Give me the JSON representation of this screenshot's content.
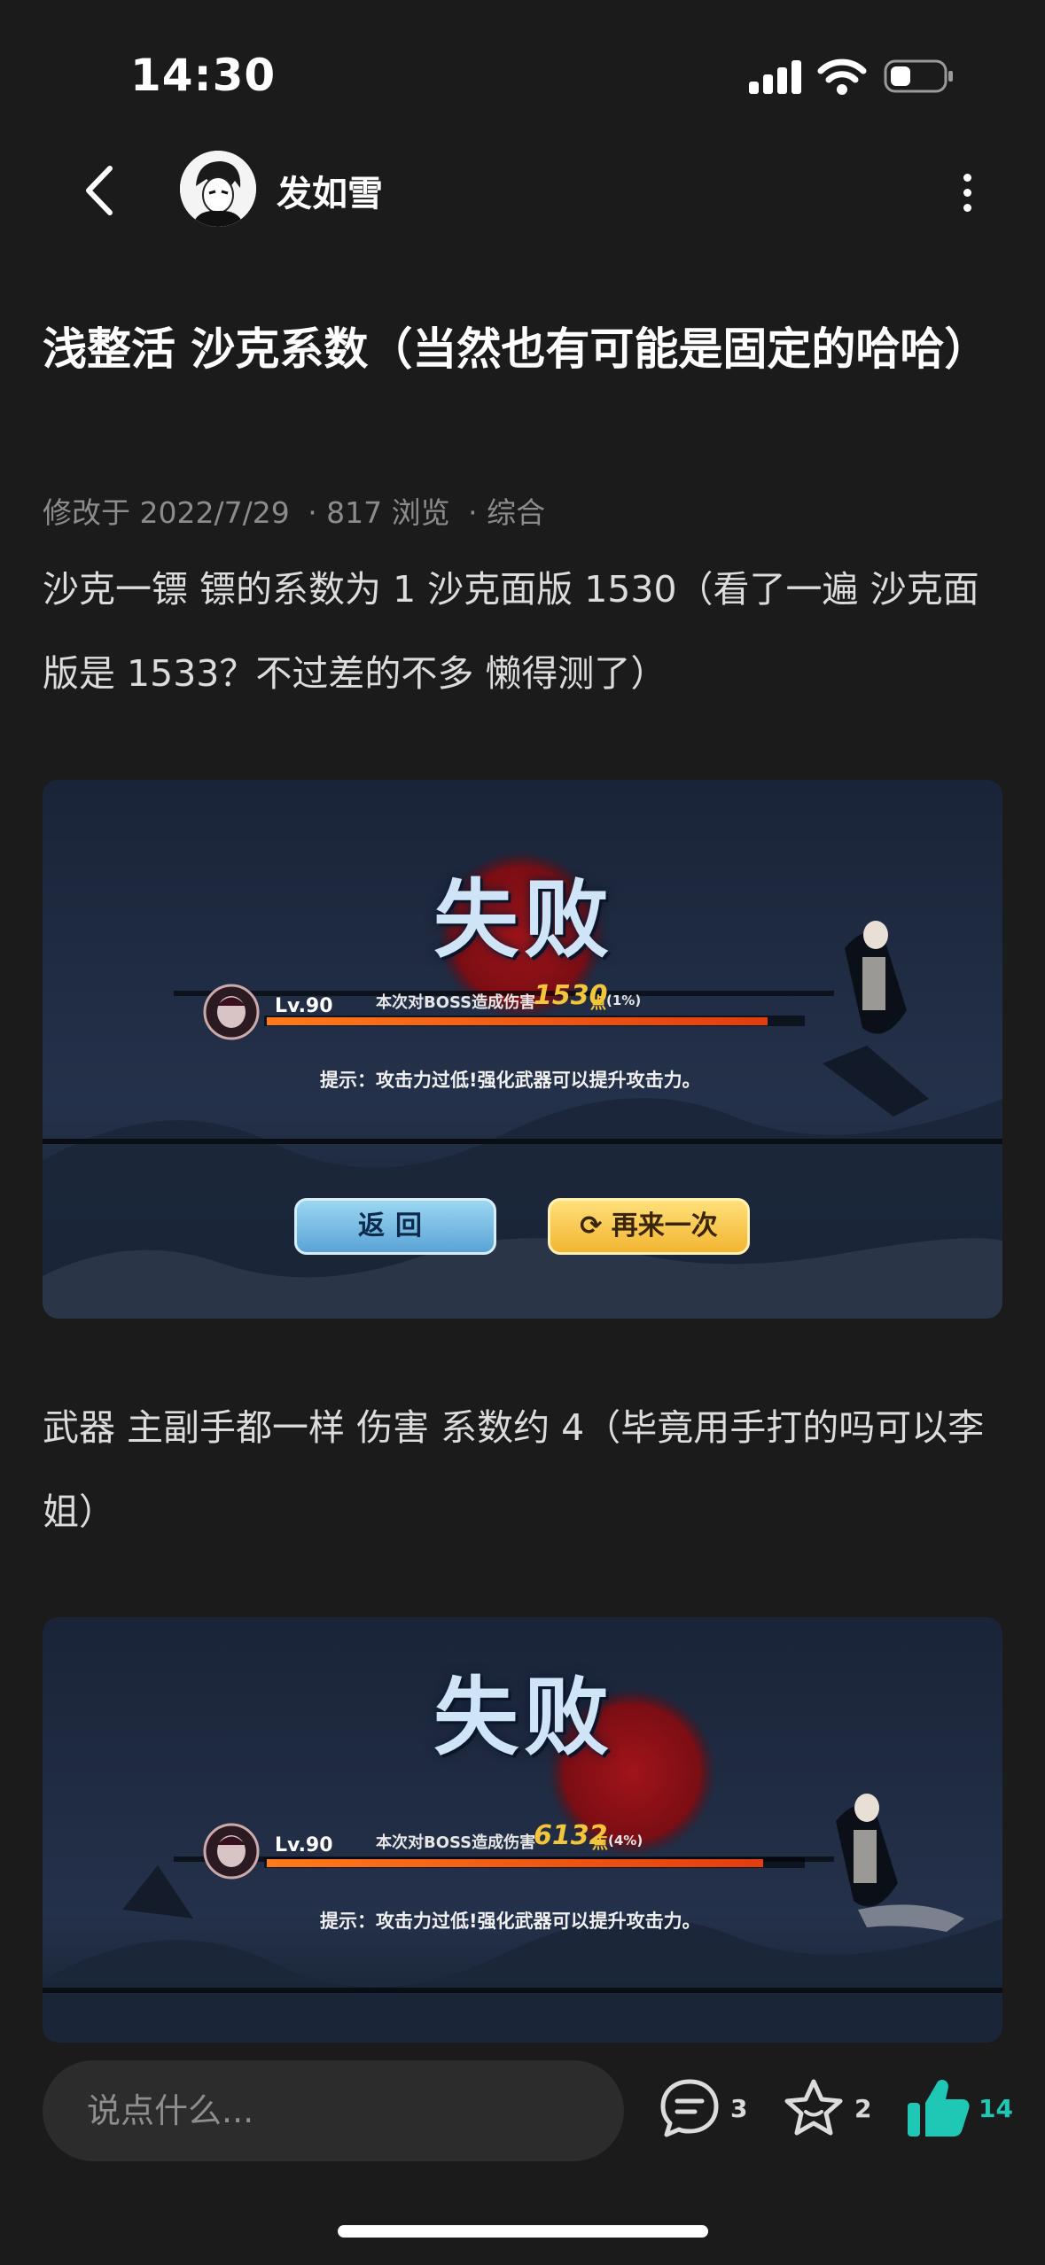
{
  "status_bar": {
    "time": "14:30"
  },
  "header": {
    "author_name": "发如雪"
  },
  "post": {
    "title": "浅整活 沙克系数（当然也有可能是固定的哈哈）",
    "meta": {
      "modified": "修改于 2022/7/29",
      "views": "· 817 浏览",
      "category": "· 综合"
    },
    "paragraph_1": "沙克一镖 镖的系数为 1 沙克面版 1530（看了一遍 沙克面版是 1533？不过差的不多 懒得测了）",
    "paragraph_2": "武器 主副手都一样 伤害 系数约 4（毕竟用手打的吗可以李姐）"
  },
  "screenshots": [
    {
      "title": "失败",
      "level": "Lv.90",
      "damage_label": "本次对BOSS造成伤害",
      "damage_value": "1530",
      "damage_unit": "点",
      "damage_percent": "(1%)",
      "health_fraction": 0.99,
      "tip": "提示：攻击力过低!强化武器可以提升攻击力。",
      "back_button": "返回",
      "retry_button": "再来一次"
    },
    {
      "title": "失败",
      "level": "Lv.90",
      "damage_label": "本次对BOSS造成伤害",
      "damage_value": "6132",
      "damage_unit": "点",
      "damage_percent": "(4%)",
      "health_fraction": 0.96,
      "tip": "提示：攻击力过低!强化武器可以提升攻击力。"
    }
  ],
  "bottom_bar": {
    "comment_placeholder": "说点什么...",
    "comments_count": "3",
    "favorites_count": "2",
    "likes_count": "14"
  },
  "colors": {
    "background": "#1b1b1b",
    "like_accent": "#1fc8b4",
    "damage_gold": "#f3c53b"
  }
}
